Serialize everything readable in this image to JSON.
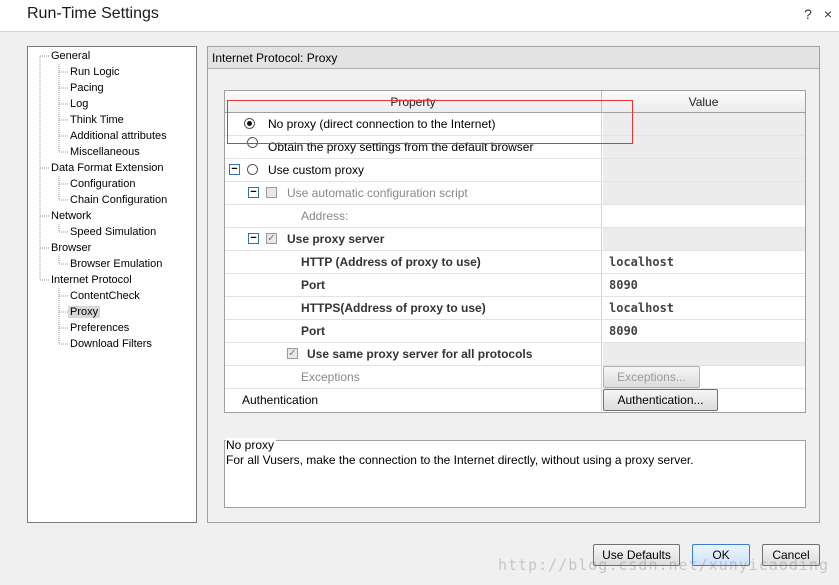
{
  "window": {
    "title": "Run-Time Settings",
    "help_label": "?",
    "close_label": "×"
  },
  "tree": {
    "nodes": [
      {
        "label": "General",
        "level": 0
      },
      {
        "label": "Run Logic",
        "level": 1
      },
      {
        "label": "Pacing",
        "level": 1
      },
      {
        "label": "Log",
        "level": 1
      },
      {
        "label": "Think Time",
        "level": 1
      },
      {
        "label": "Additional attributes",
        "level": 1
      },
      {
        "label": "Miscellaneous",
        "level": 1
      },
      {
        "label": "Data Format Extension",
        "level": 0
      },
      {
        "label": "Configuration",
        "level": 1
      },
      {
        "label": "Chain Configuration",
        "level": 1
      },
      {
        "label": "Network",
        "level": 0
      },
      {
        "label": "Speed Simulation",
        "level": 1
      },
      {
        "label": "Browser",
        "level": 0
      },
      {
        "label": "Browser Emulation",
        "level": 1
      },
      {
        "label": "Internet Protocol",
        "level": 0
      },
      {
        "label": "ContentCheck",
        "level": 1
      },
      {
        "label": "Proxy",
        "level": 1,
        "selected": true
      },
      {
        "label": "Preferences",
        "level": 1
      },
      {
        "label": "Download Filters",
        "level": 1
      }
    ]
  },
  "panel": {
    "header": "Internet Protocol: Proxy",
    "columns": {
      "property": "Property",
      "value": "Value"
    },
    "rows": {
      "no_proxy": "No proxy (direct connection to the Internet)",
      "obtain": "Obtain the proxy settings from the default browser",
      "custom": "Use custom proxy",
      "auto_script": "Use automatic configuration script",
      "address": "Address:",
      "use_proxy_server": "Use proxy server",
      "http": "HTTP (Address of proxy to use)",
      "http_value": "localhost",
      "port1": "Port",
      "port1_value": "8090",
      "https": "HTTPS(Address of proxy to use)",
      "https_value": "localhost",
      "port2": "Port",
      "port2_value": "8090",
      "same_proxy": "Use same proxy server for all protocols",
      "exceptions": "Exceptions",
      "exceptions_btn": "Exceptions...",
      "authentication": "Authentication",
      "authentication_btn": "Authentication..."
    },
    "description": {
      "title": "No proxy",
      "text": "For all Vusers, make the connection to the Internet directly, without using a proxy server."
    }
  },
  "footer": {
    "use_defaults": "Use Defaults",
    "ok": "OK",
    "cancel": "Cancel"
  },
  "watermark": "http://blog.csdn.net/xunyicaoding",
  "colors": {
    "highlight": "#e33333",
    "selected_tree": "#d8d8d8"
  }
}
